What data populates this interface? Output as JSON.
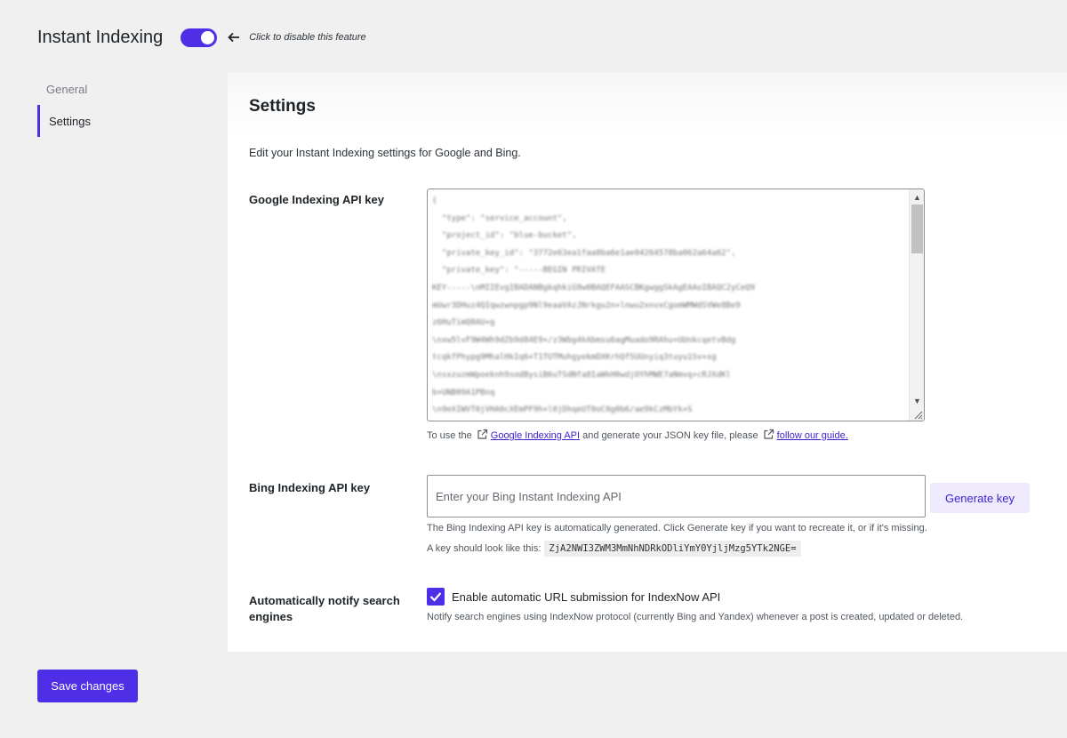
{
  "header": {
    "title": "Instant Indexing",
    "toggle_on": true,
    "hint": "Click to disable this feature"
  },
  "sidebar": {
    "items": [
      {
        "label": "General",
        "active": false
      },
      {
        "label": "Settings",
        "active": true
      }
    ]
  },
  "main": {
    "title": "Settings",
    "description": "Edit your Instant Indexing settings for Google and Bing.",
    "google": {
      "label": "Google Indexing API key",
      "help_prefix": "To use the",
      "link1": "Google Indexing API",
      "help_middle": "and generate your JSON key file, please",
      "link2": "follow our guide."
    },
    "bing": {
      "label": "Bing Indexing API key",
      "placeholder": "Enter your Bing Instant Indexing API",
      "generate_label": "Generate key",
      "help": "The Bing Indexing API key is automatically generated. Click Generate key if you want to recreate it, or if it's missing.",
      "example_prefix": "A key should look like this:",
      "example_key": "ZjA2NWI3ZWM3MmNhNDRkODliYmY0YjljMzg5YTk2NGE="
    },
    "notify": {
      "label": "Automatically notify search engines",
      "checkbox_label": "Enable automatic URL submission for IndexNow API",
      "checked": true,
      "help": "Notify search engines using IndexNow protocol (currently Bing and Yandex) whenever a post is created, updated or deleted."
    }
  },
  "footer": {
    "save_label": "Save changes"
  },
  "colors": {
    "accent": "#4f2ee8",
    "link": "#3c1fd1",
    "background": "#f0f0f1"
  }
}
